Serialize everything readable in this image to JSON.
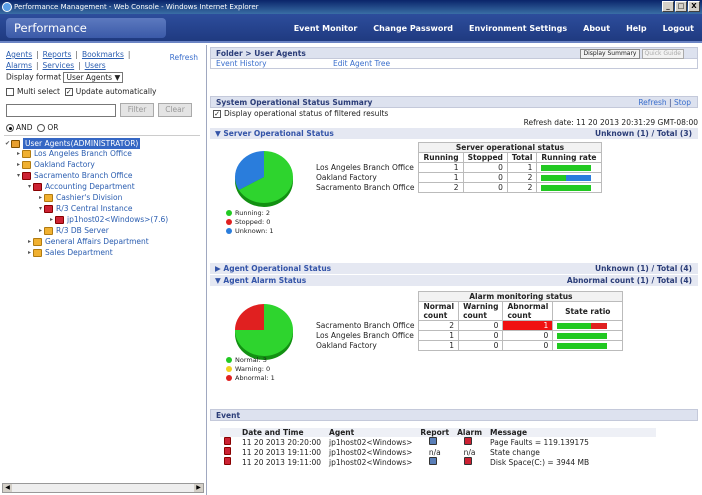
{
  "window": {
    "title": "Performance Management - Web Console - Windows Internet Explorer",
    "controls": [
      "_",
      "□",
      "X"
    ]
  },
  "app": {
    "title": "Performance Management"
  },
  "menu": [
    "Event Monitor",
    "Change Password",
    "Environment Settings",
    "About",
    "Help",
    "Logout"
  ],
  "leftnav": {
    "agents": "Agents",
    "reports": "Reports",
    "bookmarks": "Bookmarks",
    "alarms": "Alarms",
    "services": "Services",
    "users": "Users",
    "refresh": "Refresh",
    "display_format_label": "Display format",
    "display_format_value": "User Agents",
    "multi_select": "Multi select",
    "update_auto": "Update automatically",
    "filter_btn": "Filter",
    "clear_btn": "Clear",
    "and_label": "AND",
    "or_label": "OR"
  },
  "tree": [
    {
      "label": "User Agents(ADMINISTRATOR)",
      "level": 0,
      "selected": true,
      "icon": "user"
    },
    {
      "label": "Los Angeles Branch Office",
      "level": 1,
      "icon": "folder"
    },
    {
      "label": "Oakland Factory",
      "level": 1,
      "icon": "folder"
    },
    {
      "label": "Sacramento Branch Office",
      "level": 1,
      "icon": "host"
    },
    {
      "label": "Accounting Department",
      "level": 2,
      "icon": "host"
    },
    {
      "label": "Cashier's Division",
      "level": 3,
      "icon": "folder"
    },
    {
      "label": "R/3 Central Instance",
      "level": 3,
      "icon": "host"
    },
    {
      "label": "jp1host02<Windows>(7.6)",
      "level": 4,
      "icon": "host"
    },
    {
      "label": "R/3 DB Server",
      "level": 3,
      "icon": "folder"
    },
    {
      "label": "General Affairs Department",
      "level": 2,
      "icon": "folder"
    },
    {
      "label": "Sales Department",
      "level": 2,
      "icon": "folder"
    }
  ],
  "folder": {
    "breadcrumb": "Folder > User Agents",
    "display_summary": "Display Summary",
    "quick_guide": "Quick Guide",
    "event_history": "Event History",
    "edit_agent_tree": "Edit Agent Tree"
  },
  "summary": {
    "title": "System Operational Status Summary",
    "refresh": "Refresh",
    "stop": "Stop",
    "filtered_label": "Display operational status of filtered results",
    "refresh_date": "Refresh date: 11 20 2013 20:31:29 GMT-08:00"
  },
  "server": {
    "title": "Server Operational Status",
    "counts": "Unknown (1) / Total (3)",
    "group_header": "Server operational status",
    "columns": [
      "Running",
      "Stopped",
      "Total",
      "Running rate"
    ],
    "rows": [
      {
        "name": "Los Angeles Branch Office",
        "running": "1",
        "stopped": "0",
        "total": "1",
        "run_frac": 1,
        "unknown_frac": 0
      },
      {
        "name": "Oakland Factory",
        "running": "1",
        "stopped": "0",
        "total": "2",
        "run_frac": 0.5,
        "unknown_frac": 0.5
      },
      {
        "name": "Sacramento Branch Office",
        "running": "2",
        "stopped": "0",
        "total": "2",
        "run_frac": 1,
        "unknown_frac": 0
      }
    ],
    "legend": [
      "Running: 2",
      "Stopped: 0",
      "Unknown: 1"
    ]
  },
  "agent_op": {
    "title": "Agent Operational Status",
    "counts": "Unknown (1) / Total (4)"
  },
  "alarm": {
    "title": "Agent Alarm Status",
    "counts": "Abnormal count (1) / Total (4)",
    "group_header": "Alarm monitoring status",
    "columns": [
      "Normal count",
      "Warning count",
      "Abnormal count",
      "State ratio"
    ],
    "rows": [
      {
        "name": "Sacramento Branch Office",
        "normal": "2",
        "warning": "0",
        "abnormal": "1",
        "normal_frac": 0.67,
        "abnormal_frac": 0.33
      },
      {
        "name": "Los Angeles Branch Office",
        "normal": "1",
        "warning": "0",
        "abnormal": "0",
        "normal_frac": 1,
        "abnormal_frac": 0
      },
      {
        "name": "Oakland Factory",
        "normal": "1",
        "warning": "0",
        "abnormal": "0",
        "normal_frac": 1,
        "abnormal_frac": 0
      }
    ],
    "legend": [
      "Normal: 3",
      "Warning: 0",
      "Abnormal: 1"
    ]
  },
  "event": {
    "title": "Event",
    "columns": [
      "Date and Time",
      "Agent",
      "Report",
      "Alarm",
      "Message"
    ],
    "rows": [
      {
        "time": "11 20 2013 20:20:00",
        "agent": "jp1host02<Windows>",
        "report": "",
        "alarm": "",
        "message": "Page Faults = 119.139175"
      },
      {
        "time": "11 20 2013 19:11:00",
        "agent": "jp1host02<Windows>",
        "report": "n/a",
        "alarm": "n/a",
        "message": "State change"
      },
      {
        "time": "11 20 2013 19:11:00",
        "agent": "jp1host02<Windows>",
        "report": "",
        "alarm": "",
        "message": "Disk Space(C:) = 3944 MB"
      }
    ]
  },
  "colors": {
    "running": "#22c922",
    "stopped": "#e02020",
    "unknown": "#2a7ddc",
    "warning": "#f0d020"
  }
}
